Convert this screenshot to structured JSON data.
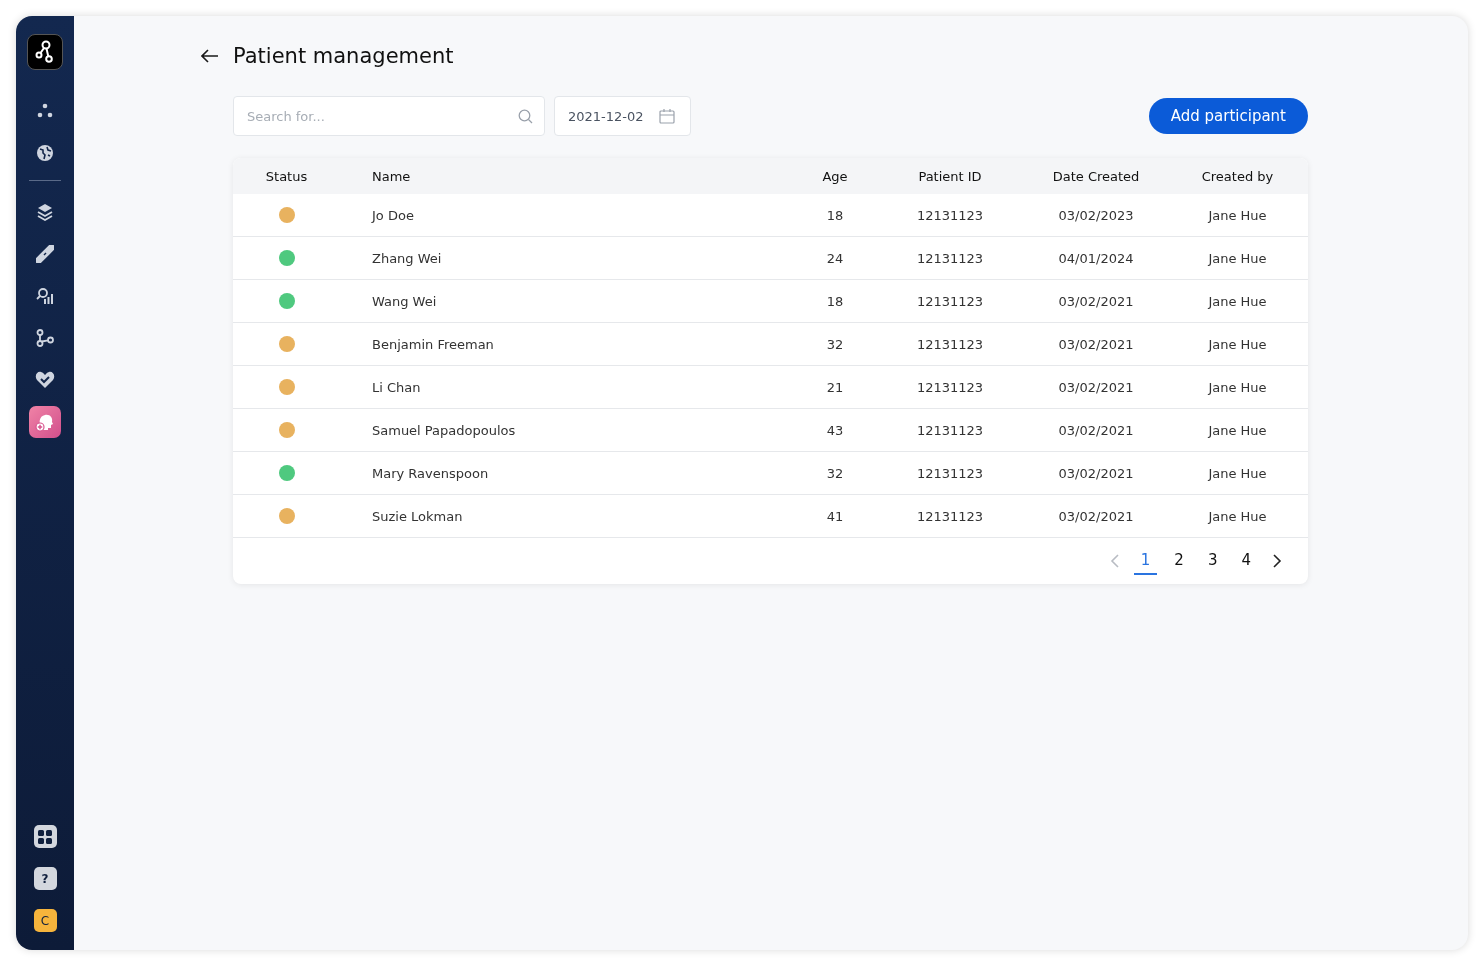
{
  "sidebar": {
    "items": [
      {
        "selected": false
      },
      {
        "selected": false
      },
      {
        "selected": false
      },
      {
        "selected": false
      },
      {
        "selected": false
      },
      {
        "selected": false
      },
      {
        "selected": false
      },
      {
        "selected": true
      }
    ],
    "help": "?",
    "user_initial": "C"
  },
  "header": {
    "title": "Patient management"
  },
  "search": {
    "placeholder": "Search for..."
  },
  "date_field": {
    "value": "2021-12-02"
  },
  "add_button": "Add participant",
  "table": {
    "columns": [
      "Status",
      "Name",
      "Age",
      "Patient ID",
      "Date Created",
      "Created by"
    ],
    "rows": [
      {
        "color": "#e8b25f",
        "name": "Jo Doe",
        "age": "18",
        "patient_id": "12131123",
        "date_created": "03/02/2023",
        "created_by": "Jane Hue"
      },
      {
        "color": "#4fc97f",
        "name": "Zhang Wei",
        "age": "24",
        "patient_id": "12131123",
        "date_created": "04/01/2024",
        "created_by": "Jane Hue"
      },
      {
        "color": "#4fc97f",
        "name": "Wang Wei",
        "age": "18",
        "patient_id": "12131123",
        "date_created": "03/02/2021",
        "created_by": "Jane Hue"
      },
      {
        "color": "#e8b25f",
        "name": "Benjamin Freeman",
        "age": "32",
        "patient_id": "12131123",
        "date_created": "03/02/2021",
        "created_by": "Jane Hue"
      },
      {
        "color": "#e8b25f",
        "name": "Li Chan",
        "age": "21",
        "patient_id": "12131123",
        "date_created": "03/02/2021",
        "created_by": "Jane Hue"
      },
      {
        "color": "#e8b25f",
        "name": "Samuel Papadopoulos",
        "age": "43",
        "patient_id": "12131123",
        "date_created": "03/02/2021",
        "created_by": "Jane Hue"
      },
      {
        "color": "#4fc97f",
        "name": "Mary Ravenspoon",
        "age": "32",
        "patient_id": "12131123",
        "date_created": "03/02/2021",
        "created_by": "Jane Hue"
      },
      {
        "color": "#e8b25f",
        "name": "Suzie Lokman",
        "age": "41",
        "patient_id": "12131123",
        "date_created": "03/02/2021",
        "created_by": "Jane Hue"
      }
    ]
  },
  "pagination": {
    "prev_disabled": true,
    "next_disabled": false,
    "pages": [
      {
        "label": "1",
        "selected": true
      },
      {
        "label": "2",
        "selected": false
      },
      {
        "label": "3",
        "selected": false
      },
      {
        "label": "4",
        "selected": false
      }
    ]
  }
}
